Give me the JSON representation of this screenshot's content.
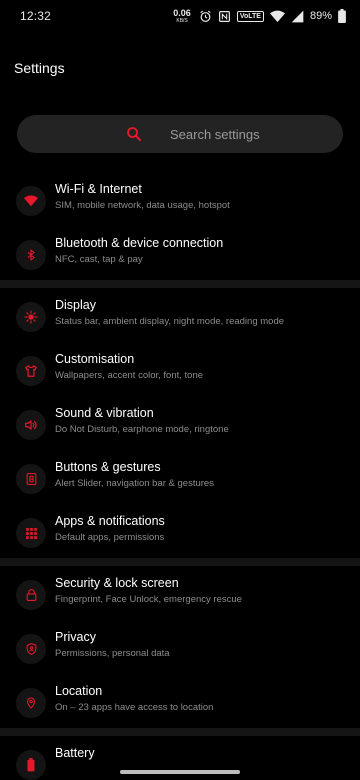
{
  "status_bar": {
    "time": "12:32",
    "net_speed_value": "0.06",
    "net_speed_unit": "KB/S",
    "volte_label": "VoLTE",
    "battery_percent": "89%",
    "icons": [
      "nfc-icon",
      "alarm-icon",
      "wifi-icon",
      "signal-icon",
      "battery-icon"
    ]
  },
  "header": {
    "title": "Settings"
  },
  "search": {
    "placeholder": "Search settings"
  },
  "accent_color": "#e8182c",
  "settings": {
    "items": [
      {
        "title": "Wi-Fi & Internet",
        "subtitle": "SIM, mobile network, data usage, hotspot",
        "icon": "wifi-icon"
      },
      {
        "title": "Bluetooth & device connection",
        "subtitle": "NFC, cast, tap & pay",
        "icon": "bluetooth-icon"
      },
      {
        "title": "Display",
        "subtitle": "Status bar, ambient display, night mode, reading mode",
        "icon": "brightness-icon"
      },
      {
        "title": "Customisation",
        "subtitle": "Wallpapers, accent color, font, tone",
        "icon": "tshirt-icon"
      },
      {
        "title": "Sound & vibration",
        "subtitle": "Do Not Disturb, earphone mode, ringtone",
        "icon": "speaker-icon"
      },
      {
        "title": "Buttons & gestures",
        "subtitle": "Alert Slider, navigation bar & gestures",
        "icon": "buttons-icon"
      },
      {
        "title": "Apps & notifications",
        "subtitle": "Default apps, permissions",
        "icon": "apps-grid-icon"
      },
      {
        "title": "Security & lock screen",
        "subtitle": "Fingerprint, Face Unlock, emergency rescue",
        "icon": "lock-icon"
      },
      {
        "title": "Privacy",
        "subtitle": "Permissions, personal data",
        "icon": "privacy-shield-icon"
      },
      {
        "title": "Location",
        "subtitle": "On – 23 apps have access to location",
        "icon": "location-pin-icon"
      },
      {
        "title": "Battery",
        "subtitle": "",
        "icon": "battery-icon"
      }
    ]
  }
}
